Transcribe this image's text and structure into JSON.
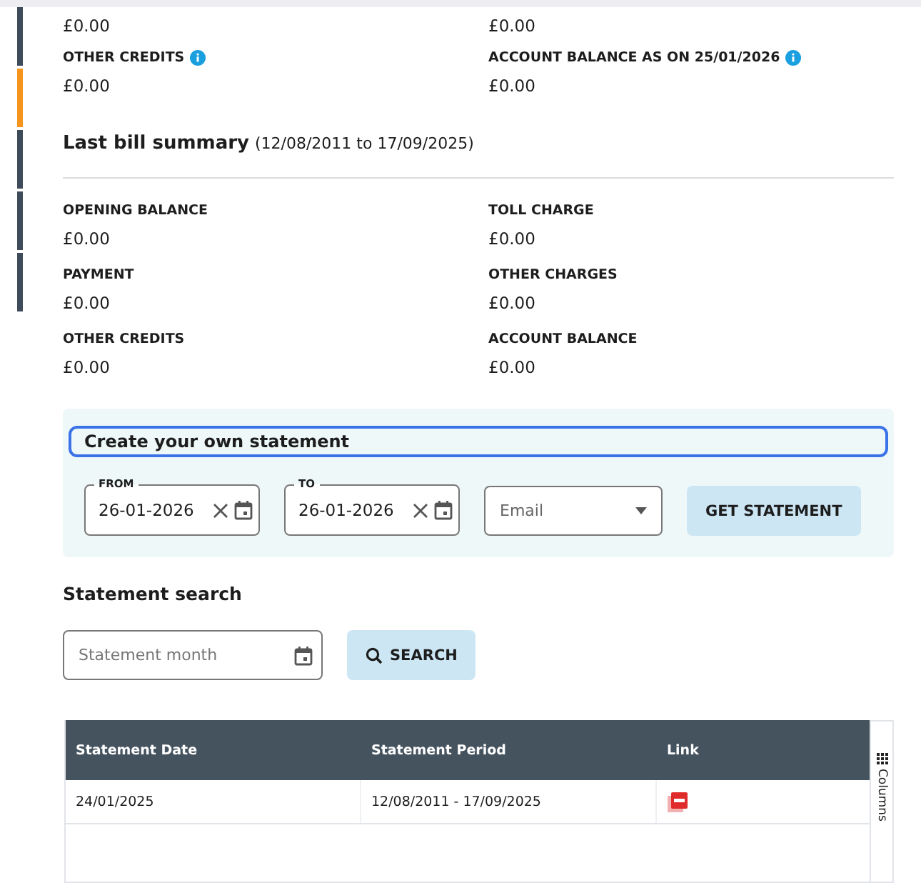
{
  "side_markers": [
    {
      "selected": false
    },
    {
      "selected": true
    },
    {
      "selected": false
    },
    {
      "selected": false
    },
    {
      "selected": false
    }
  ],
  "current_summary": {
    "top_values": [
      "£0.00",
      "£0.00"
    ],
    "items": [
      {
        "label": "OTHER CREDITS",
        "info": true,
        "value": "£0.00"
      },
      {
        "label": "ACCOUNT BALANCE AS ON 25/01/2026",
        "info": true,
        "value": "£0.00"
      }
    ]
  },
  "last_bill": {
    "title": "Last bill summary",
    "period": "(12/08/2011 to 17/09/2025)",
    "items": [
      {
        "label": "OPENING BALANCE",
        "value": "£0.00"
      },
      {
        "label": "TOLL CHARGE",
        "value": "£0.00"
      },
      {
        "label": "PAYMENT",
        "value": "£0.00"
      },
      {
        "label": "OTHER CHARGES",
        "value": "£0.00"
      },
      {
        "label": "OTHER CREDITS",
        "value": "£0.00"
      },
      {
        "label": "ACCOUNT BALANCE",
        "value": "£0.00"
      }
    ]
  },
  "create_statement": {
    "title": "Create your own statement",
    "from": {
      "label": "FROM",
      "value": "26-01-2026"
    },
    "to": {
      "label": "TO",
      "value": "26-01-2026"
    },
    "delivery": {
      "placeholder": "Email"
    },
    "button": "GET STATEMENT"
  },
  "statement_search": {
    "title": "Statement search",
    "month": {
      "placeholder": "Statement month"
    },
    "button": "SEARCH"
  },
  "table": {
    "columns": [
      "Statement Date",
      "Statement Period",
      "Link"
    ],
    "columns_panel": "Columns",
    "rows": [
      {
        "date": "24/01/2025",
        "period": "12/08/2011 - 17/09/2025"
      }
    ]
  }
}
